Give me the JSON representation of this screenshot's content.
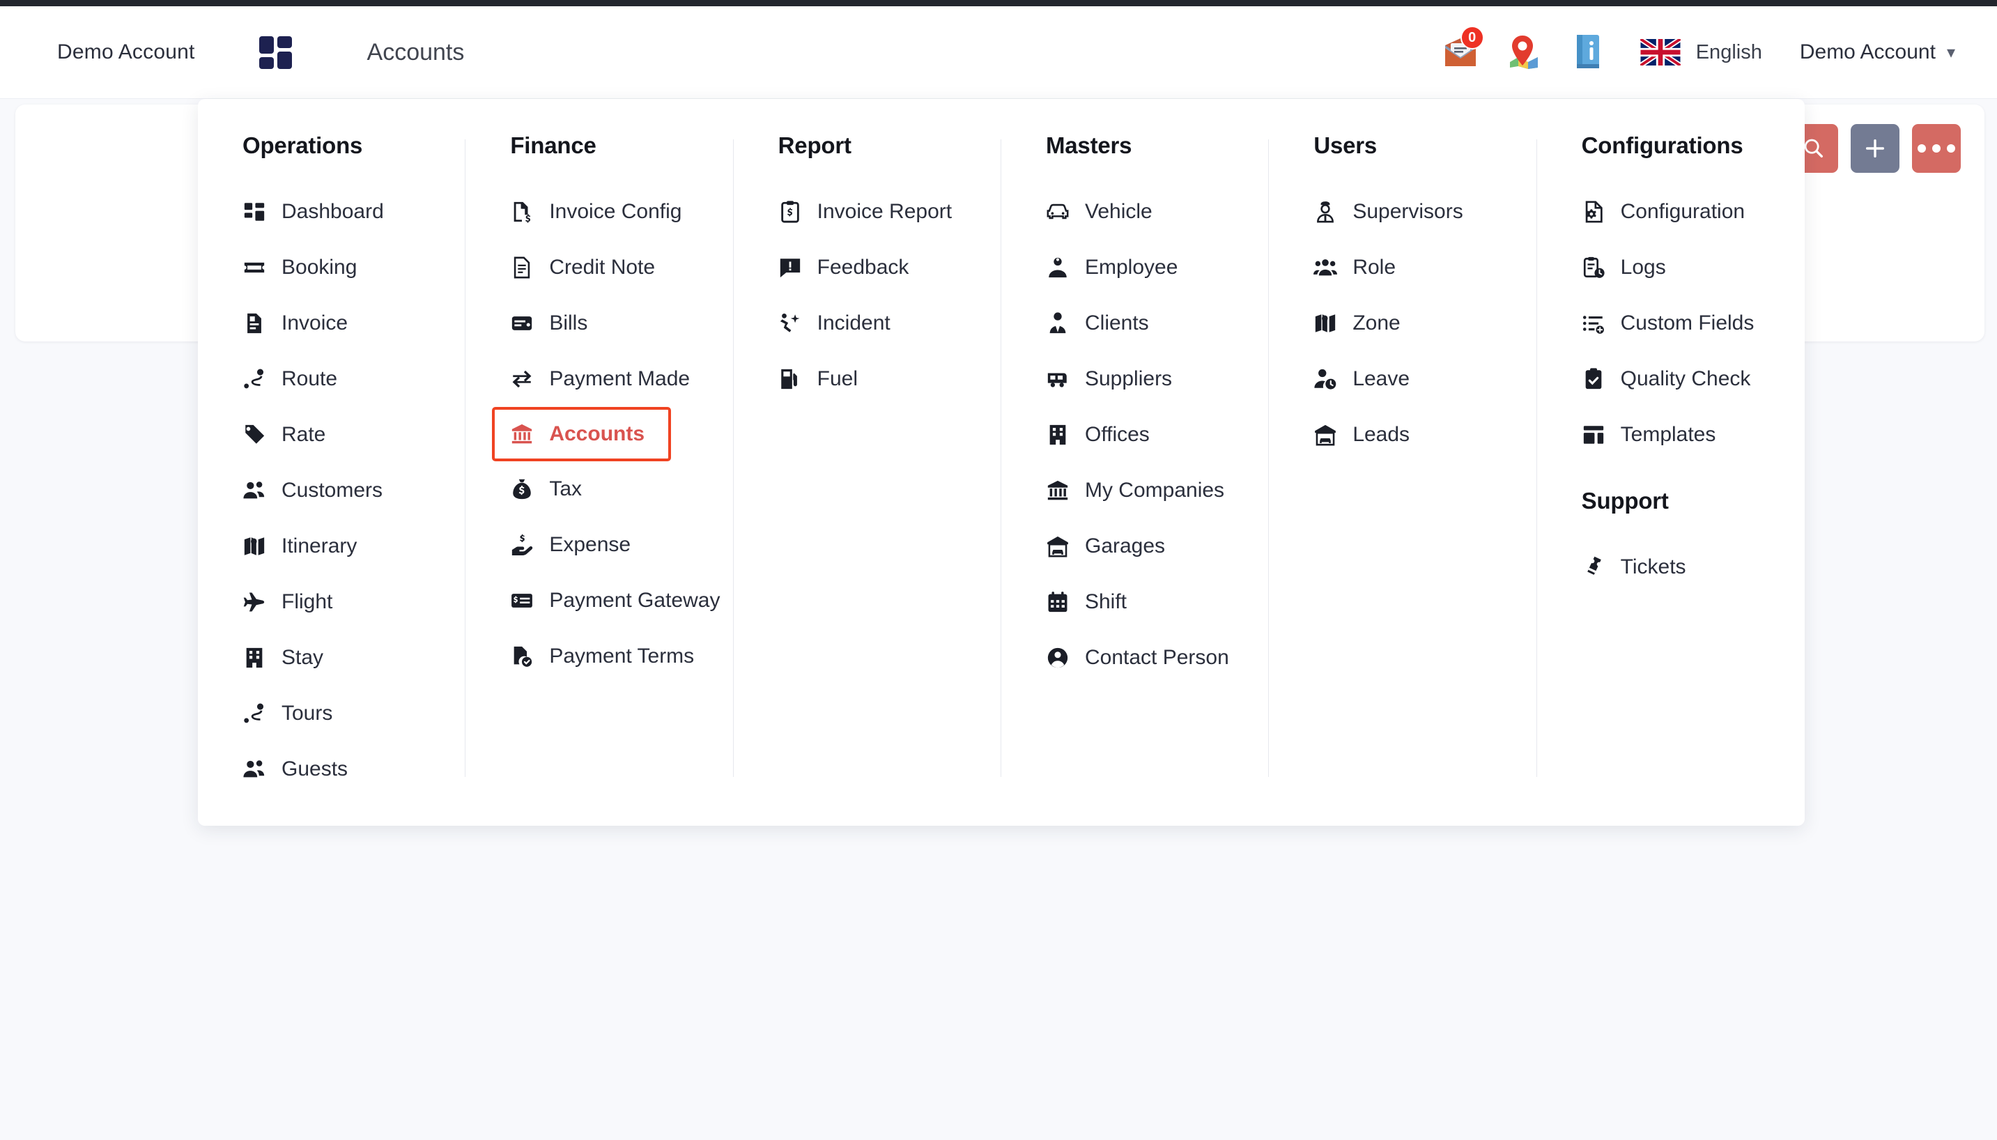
{
  "header": {
    "account_name": "Demo Account",
    "logo_icon": "grid-logo-icon",
    "page_title": "Accounts",
    "mail_icon": "mail-envelope-icon",
    "mail_badge": "0",
    "map_icon": "map-pin-icon",
    "info_icon": "info-book-icon",
    "flag_icon": "uk-flag-icon",
    "language": "English",
    "user_menu": "Demo Account",
    "chevron_icon": "chevron-down-icon"
  },
  "toolbar": {
    "search_icon": "search-icon",
    "add_icon": "plus-icon",
    "more_icon": "ellipsis-icon"
  },
  "menu": {
    "columns": [
      {
        "title": "Operations",
        "items": [
          {
            "label": "Dashboard",
            "icon": "dashboard-grid-icon"
          },
          {
            "label": "Booking",
            "icon": "ticket-icon"
          },
          {
            "label": "Invoice",
            "icon": "invoice-document-icon"
          },
          {
            "label": "Route",
            "icon": "route-icon"
          },
          {
            "label": "Rate",
            "icon": "tag-icon"
          },
          {
            "label": "Customers",
            "icon": "users-icon"
          },
          {
            "label": "Itinerary",
            "icon": "map-folded-icon"
          },
          {
            "label": "Flight",
            "icon": "plane-icon"
          },
          {
            "label": "Stay",
            "icon": "hotel-icon"
          },
          {
            "label": "Tours",
            "icon": "route-icon"
          },
          {
            "label": "Guests",
            "icon": "users-icon"
          }
        ]
      },
      {
        "title": "Finance",
        "items": [
          {
            "label": "Invoice Config",
            "icon": "invoice-dollar-icon"
          },
          {
            "label": "Credit Note",
            "icon": "document-lines-icon"
          },
          {
            "label": "Bills",
            "icon": "card-bill-icon"
          },
          {
            "label": "Payment Made",
            "icon": "exchange-arrows-icon"
          },
          {
            "label": "Accounts",
            "icon": "bank-icon",
            "active": true
          },
          {
            "label": "Tax",
            "icon": "money-bag-icon"
          },
          {
            "label": "Expense",
            "icon": "hand-dollar-icon"
          },
          {
            "label": "Payment Gateway",
            "icon": "money-check-icon"
          },
          {
            "label": "Payment Terms",
            "icon": "document-check-icon"
          }
        ]
      },
      {
        "title": "Report",
        "items": [
          {
            "label": "Invoice Report",
            "icon": "clipboard-dollar-icon"
          },
          {
            "label": "Feedback",
            "icon": "comment-alert-icon"
          },
          {
            "label": "Incident",
            "icon": "person-falling-icon"
          },
          {
            "label": "Fuel",
            "icon": "fuel-pump-icon"
          }
        ]
      },
      {
        "title": "Masters",
        "items": [
          {
            "label": "Vehicle",
            "icon": "car-icon"
          },
          {
            "label": "Employee",
            "icon": "employee-badge-icon"
          },
          {
            "label": "Clients",
            "icon": "person-tie-icon"
          },
          {
            "label": "Suppliers",
            "icon": "trailer-icon"
          },
          {
            "label": "Offices",
            "icon": "office-building-icon"
          },
          {
            "label": "My Companies",
            "icon": "bank-icon"
          },
          {
            "label": "Garages",
            "icon": "garage-icon"
          },
          {
            "label": "Shift",
            "icon": "calendar-grid-icon"
          },
          {
            "label": "Contact Person",
            "icon": "user-circle-icon"
          }
        ]
      },
      {
        "title": "Users",
        "items": [
          {
            "label": "Supervisors",
            "icon": "supervisor-icon"
          },
          {
            "label": "Role",
            "icon": "user-group-icon"
          },
          {
            "label": "Zone",
            "icon": "map-folded-icon"
          },
          {
            "label": "Leave",
            "icon": "user-clock-icon"
          },
          {
            "label": "Leads",
            "icon": "garage-icon"
          }
        ]
      },
      {
        "title": "Configurations",
        "items": [
          {
            "label": "Configuration",
            "icon": "file-gear-icon"
          },
          {
            "label": "Logs",
            "icon": "clipboard-clock-icon"
          },
          {
            "label": "Custom Fields",
            "icon": "list-plus-icon"
          },
          {
            "label": "Quality Check",
            "icon": "clipboard-check-icon"
          },
          {
            "label": "Templates",
            "icon": "layout-template-icon"
          }
        ],
        "subsection": {
          "title": "Support",
          "items": [
            {
              "label": "Tickets",
              "icon": "ticket-tilted-icon"
            }
          ]
        }
      }
    ]
  },
  "colors": {
    "accent_red": "#f04322",
    "active_text": "#d9534f",
    "logo_navy": "#1d2150",
    "button_red": "#d46a63",
    "button_slate": "#737b93",
    "page_bg": "#f8f9fc"
  }
}
